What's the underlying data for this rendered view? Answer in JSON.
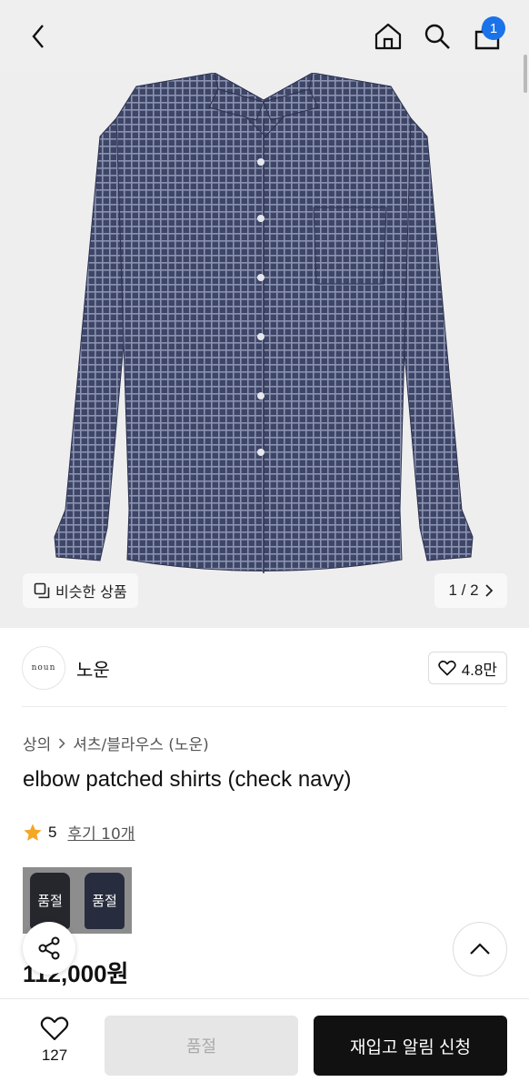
{
  "header": {
    "cart_count": "1"
  },
  "gallery": {
    "similar_label": "비슷한 상품",
    "page_indicator": "1 / 2"
  },
  "brand": {
    "logo_text": "noun",
    "name": "노운",
    "likes": "4.8만"
  },
  "breadcrumb": {
    "category": "상의",
    "subcategory": "셔츠/블라우스 (노운)"
  },
  "product": {
    "title": "elbow patched shirts (check navy)",
    "rating": "5",
    "reviews": "후기 10개",
    "price": "112,000원",
    "variants": [
      {
        "label": "품절",
        "color": "#3a3d44"
      },
      {
        "label": "품절",
        "color": "#3c4660"
      }
    ]
  },
  "bottom": {
    "wish_count": "127",
    "soldout_label": "품절",
    "restock_label": "재입고 알림 신청"
  },
  "colors": {
    "shirt_navy": "#3e4668",
    "accent_blue": "#1a73e8",
    "star": "#f5a623"
  }
}
